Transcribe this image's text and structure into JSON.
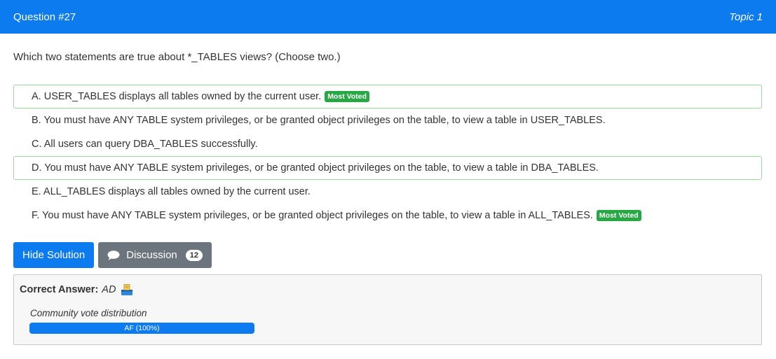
{
  "header": {
    "question": "Question #27",
    "topic": "Topic 1"
  },
  "question_text": "Which two statements are true about *_TABLES views? (Choose two.)",
  "choices": [
    {
      "text": "A. USER_TABLES displays all tables owned by the current user.",
      "badge": "Most Voted",
      "correct": true
    },
    {
      "text": "B. You must have ANY TABLE system privileges, or be granted object privileges on the table, to view a table in USER_TABLES."
    },
    {
      "text": "C. All users can query DBA_TABLES successfully."
    },
    {
      "text": "D. You must have ANY TABLE system privileges, or be granted object privileges on the table, to view a table in DBA_TABLES.",
      "correct": true
    },
    {
      "text": "E. ALL_TABLES displays all tables owned by the current user."
    },
    {
      "text": "F. You must have ANY TABLE system privileges, or be granted object privileges on the table, to view a table in ALL_TABLES.",
      "badge": "Most Voted"
    }
  ],
  "buttons": {
    "hide_solution": "Hide Solution",
    "discussion": "Discussion",
    "discussion_count": "12"
  },
  "answer": {
    "label": "Correct Answer:",
    "value": "AD",
    "icon": "voting-box-icon",
    "vote_label": "Community vote distribution",
    "vote_bar_text": "AF (100%)",
    "vote_fraction": 1.0
  },
  "colors": {
    "primary": "#0c7bf0",
    "badge": "#28a745",
    "secondary": "#6c757d",
    "correct_border": "#9fd89c"
  }
}
